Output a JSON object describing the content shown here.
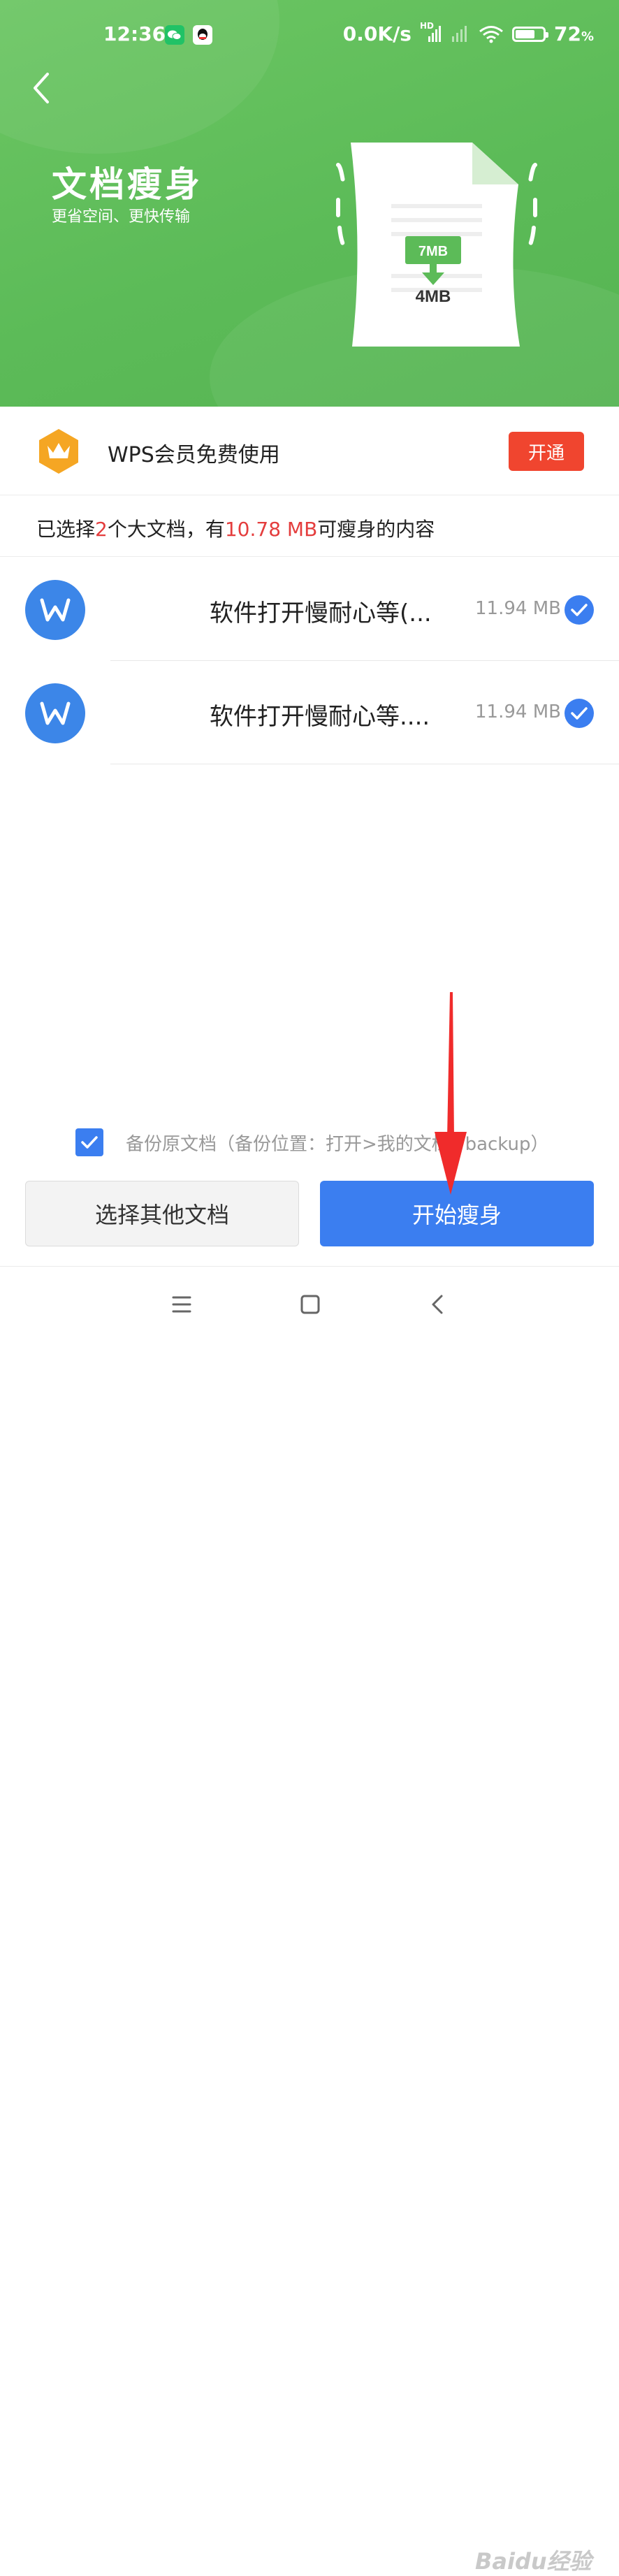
{
  "status_bar": {
    "time": "12:36",
    "network_speed": "0.0K/s",
    "network_type": "HD",
    "battery_percent": "72",
    "battery_unit": "%",
    "app_icons": [
      "wechat-icon",
      "qq-icon"
    ]
  },
  "header": {
    "title": "文档瘦身",
    "subtitle": "更省空间、更快传输",
    "illustration": {
      "from_size": "7MB",
      "to_size": "4MB"
    }
  },
  "vip": {
    "text": "WPS会员免费使用",
    "button": "开通"
  },
  "summary": {
    "prefix": "已选择",
    "count": "2",
    "middle": "个大文档，有",
    "size": "10.78 MB",
    "suffix": "可瘦身的内容"
  },
  "files": [
    {
      "name": "软件打开慢耐心等(...",
      "size": "11.94 MB",
      "selected": true
    },
    {
      "name": "软件打开慢耐心等....",
      "size": "11.94 MB",
      "selected": true
    }
  ],
  "backup": {
    "checked": true,
    "label": "备份原文档（备份位置：打开>我的文档>backup）"
  },
  "actions": {
    "select_other": "选择其他文档",
    "start": "开始瘦身"
  },
  "watermark": "Baidu经验",
  "colors": {
    "header_green": "#5cbb58",
    "accent_blue": "#3b7ef0",
    "vip_red": "#f0452f",
    "highlight_red": "#e43d3d",
    "crown_orange": "#f5a623"
  }
}
